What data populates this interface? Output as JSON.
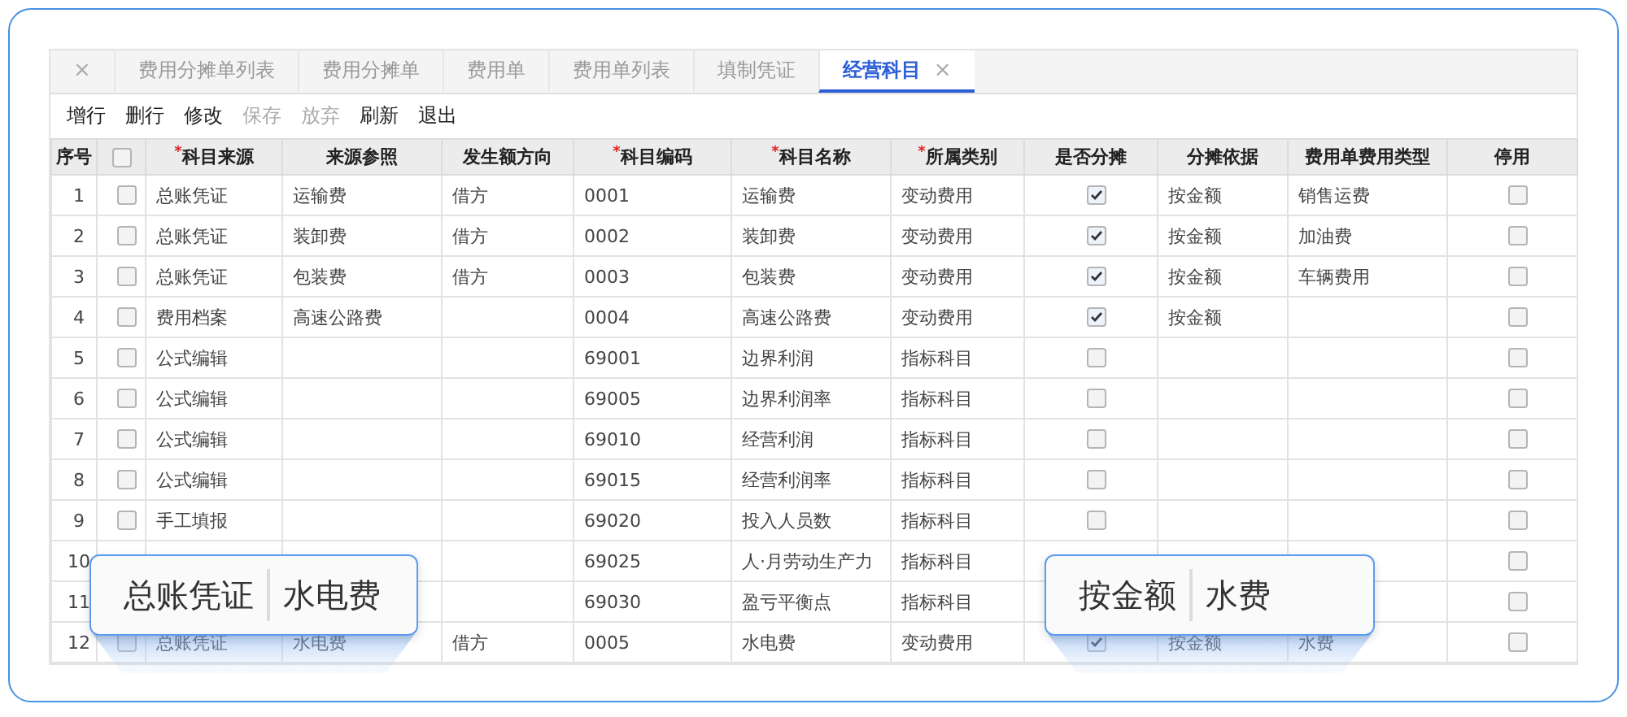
{
  "tabs": [
    {
      "close": "×",
      "selected": false
    },
    {
      "label": "费用分摊单列表",
      "selected": false
    },
    {
      "label": "费用分摊单",
      "selected": false
    },
    {
      "label": "费用单",
      "selected": false
    },
    {
      "label": "费用单列表",
      "selected": false
    },
    {
      "label": "填制凭证",
      "selected": false
    },
    {
      "label": "经营科目",
      "close": "×",
      "selected": true
    }
  ],
  "toolbar": [
    {
      "label": "增行",
      "disabled": false
    },
    {
      "label": "删行",
      "disabled": false
    },
    {
      "label": "修改",
      "disabled": false
    },
    {
      "label": "保存",
      "disabled": true
    },
    {
      "label": "放弃",
      "disabled": true
    },
    {
      "label": "刷新",
      "disabled": false
    },
    {
      "label": "退出",
      "disabled": false
    }
  ],
  "table": {
    "select_all": {
      "checked": false
    },
    "columns": [
      {
        "label": "序号"
      },
      {
        "kind": "select"
      },
      {
        "label": "科目来源",
        "mark": "*"
      },
      {
        "label": "来源参照"
      },
      {
        "label": "发生额方向"
      },
      {
        "label": "科目编码",
        "mark": "*"
      },
      {
        "label": "科目名称",
        "mark": "*"
      },
      {
        "label": "所属类别",
        "mark": "*"
      },
      {
        "label": "是否分摊"
      },
      {
        "label": "分摊依据"
      },
      {
        "label": "费用单费用类型"
      },
      {
        "label": "停用"
      }
    ],
    "rows": [
      {
        "no": "1",
        "selected": false,
        "source": "总账凭证",
        "ref": "运输费",
        "direction": "借方",
        "code": "0001",
        "name": "运输费",
        "category": "变动费用",
        "allocate": true,
        "basis": "按金额",
        "expense_type": "销售运费",
        "stopped": false
      },
      {
        "no": "2",
        "selected": false,
        "source": "总账凭证",
        "ref": "装卸费",
        "direction": "借方",
        "code": "0002",
        "name": "装卸费",
        "category": "变动费用",
        "allocate": true,
        "basis": "按金额",
        "expense_type": "加油费",
        "stopped": false
      },
      {
        "no": "3",
        "selected": false,
        "source": "总账凭证",
        "ref": "包装费",
        "direction": "借方",
        "code": "0003",
        "name": "包装费",
        "category": "变动费用",
        "allocate": true,
        "basis": "按金额",
        "expense_type": "车辆费用",
        "stopped": false
      },
      {
        "no": "4",
        "selected": false,
        "source": "费用档案",
        "ref": "高速公路费",
        "code": "0004",
        "name": "高速公路费",
        "category": "变动费用",
        "allocate": true,
        "basis": "按金额",
        "stopped": false
      },
      {
        "no": "5",
        "selected": false,
        "source": "公式编辑",
        "code": "69001",
        "name": "边界利润",
        "category": "指标科目",
        "allocate": false,
        "stopped": false
      },
      {
        "no": "6",
        "selected": false,
        "source": "公式编辑",
        "code": "69005",
        "name": "边界利润率",
        "category": "指标科目",
        "allocate": false,
        "stopped": false
      },
      {
        "no": "7",
        "selected": false,
        "source": "公式编辑",
        "code": "69010",
        "name": "经营利润",
        "category": "指标科目",
        "allocate": false,
        "stopped": false
      },
      {
        "no": "8",
        "selected": false,
        "source": "公式编辑",
        "code": "69015",
        "name": "经营利润率",
        "category": "指标科目",
        "allocate": false,
        "stopped": false
      },
      {
        "no": "9",
        "selected": false,
        "source": "手工填报",
        "code": "69020",
        "name": "投入人员数",
        "category": "指标科目",
        "allocate": false,
        "stopped": false
      },
      {
        "no": "10",
        "code": "69025",
        "name": "人·月劳动生产力",
        "category": "指标科目",
        "stopped": false
      },
      {
        "no": "11",
        "code": "69030",
        "name": "盈亏平衡点",
        "category": "指标科目",
        "stopped": false
      },
      {
        "no": "12",
        "selected": false,
        "source": "总账凭证",
        "ref": "水电费",
        "direction": "借方",
        "code": "0005",
        "name": "水电费",
        "category": "变动费用",
        "allocate": true,
        "basis": "按金额",
        "expense_type": "水费",
        "stopped": false
      }
    ]
  },
  "callouts": [
    {
      "items": [
        "总账凭证",
        "水电费"
      ]
    },
    {
      "items": [
        "按金额",
        "水费"
      ]
    }
  ]
}
